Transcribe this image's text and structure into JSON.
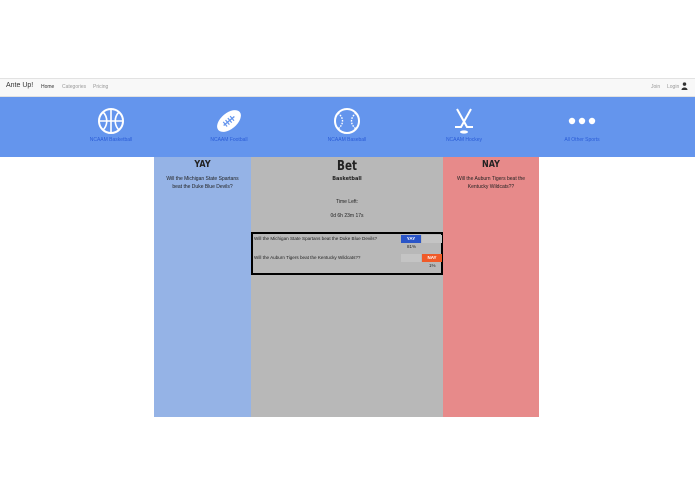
{
  "navbar": {
    "brand": "Ante Up!",
    "links": [
      {
        "label": "Home",
        "active": true
      },
      {
        "label": "Categories",
        "active": false
      },
      {
        "label": "Pricing",
        "active": false
      }
    ],
    "join_label": "Join",
    "login_label": "Login"
  },
  "sports": [
    {
      "label": "NCAAM Basketball",
      "icon": "basketball-icon"
    },
    {
      "label": "NCAAM Football",
      "icon": "football-icon"
    },
    {
      "label": "NCAAM Baseball",
      "icon": "baseball-icon"
    },
    {
      "label": "NCAAM Hockey",
      "icon": "hockey-icon"
    },
    {
      "label": "All Other Sports",
      "icon": "more-icon"
    }
  ],
  "yay": {
    "title": "YAY",
    "question": "Will the Michigan State Spartans beat the Duke Blue Devils?"
  },
  "nay": {
    "title": "NAY",
    "question": "Will the Auburn Tigers beat the Kentucky Wildcats??"
  },
  "bet": {
    "title": "Bet",
    "category": "Basketball",
    "time_left_label": "Time Left:",
    "time_left_value": "0d 6h 23m 17s",
    "bets": [
      {
        "question": "Will the Michigan State Spartans beat the Duke Blue Devils?",
        "choice": "YAY",
        "percent": "81%"
      },
      {
        "question": "Will the Auburn Tigers beat the Kentucky Wildcats??",
        "choice": "NAY",
        "percent": "1%"
      }
    ]
  },
  "colors": {
    "sports_bar": "#6495ed",
    "yay_column": "#95b3e6",
    "bet_column": "#b8b8b8",
    "nay_column": "#e78a8a",
    "yay_button": "#2a55c8",
    "nay_button": "#f05a28"
  }
}
